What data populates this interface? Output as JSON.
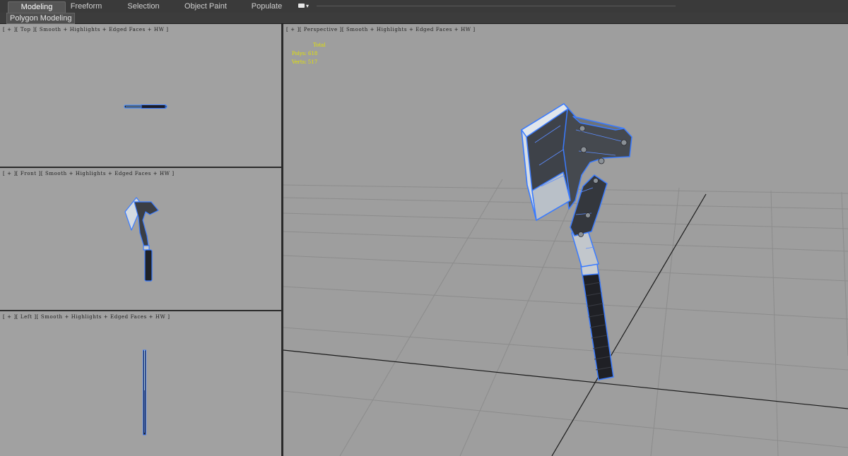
{
  "ribbon": {
    "tabs": [
      {
        "label": "Modeling",
        "active": true
      },
      {
        "label": "Freeform",
        "active": false
      },
      {
        "label": "Selection",
        "active": false
      },
      {
        "label": "Object Paint",
        "active": false
      },
      {
        "label": "Populate",
        "active": false
      }
    ],
    "options_icon": "camera-dropdown-icon",
    "panel_label": "Polygon Modeling"
  },
  "viewports": {
    "top": {
      "label": "[ + ][ Top ][ Smooth + Highlights + Edged Faces + HW ]"
    },
    "front": {
      "label": "[ + ][ Front ][ Smooth + Highlights + Edged Faces + HW ]"
    },
    "left": {
      "label": "[ + ][ Left ][ Smooth + Highlights + Edged Faces + HW ]"
    },
    "perspective": {
      "label": "[ + ][ Perspective ][ Smooth + Highlights + Edged Faces + HW ]"
    }
  },
  "stats": {
    "header": "Total",
    "polys": "Polys: 618",
    "verts": "Verts: 517"
  },
  "colors": {
    "viewport_bg": "#a1a1a1",
    "stats_text": "#e4e400",
    "selection_wire": "#3a7bff"
  }
}
